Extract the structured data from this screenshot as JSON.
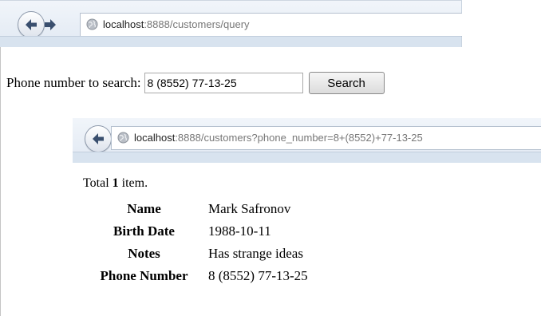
{
  "window1": {
    "url_host": "localhost",
    "url_rest": ":8888/customers/query"
  },
  "search": {
    "label": "Phone number to search:",
    "value": "8 (8552) 77-13-25",
    "button": "Search"
  },
  "window2": {
    "url_host": "localhost",
    "url_rest": ":8888/customers?phone_number=8+(8552)+77-13-25"
  },
  "result": {
    "total_prefix": "Total ",
    "total_count": "1",
    "total_suffix": " item.",
    "rows": [
      {
        "label": "Name",
        "value": "Mark Safronov"
      },
      {
        "label": "Birth Date",
        "value": "1988-10-11"
      },
      {
        "label": "Notes",
        "value": "Has strange ideas"
      },
      {
        "label": "Phone Number",
        "value": "8 (8552) 77-13-25"
      }
    ]
  }
}
